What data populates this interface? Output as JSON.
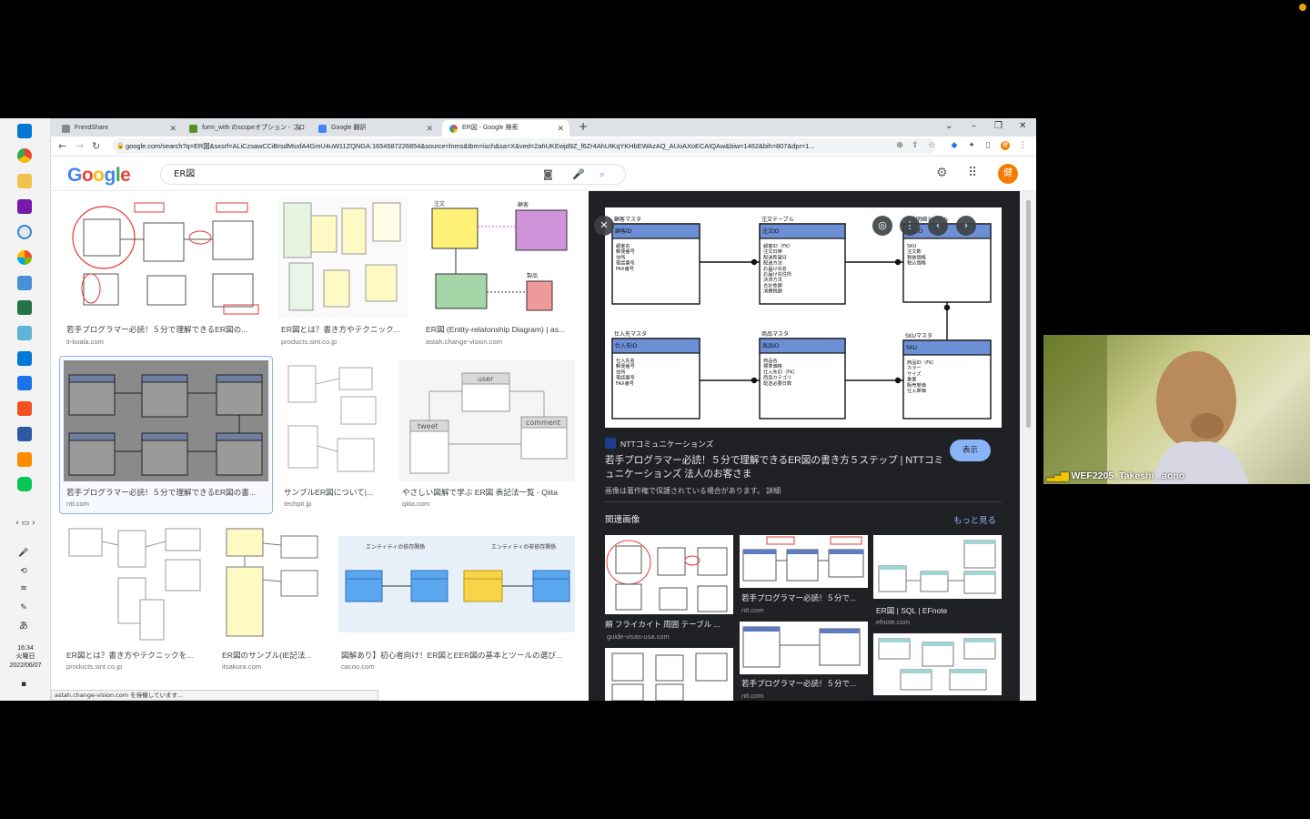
{
  "tabs": [
    {
      "label": "FrendShare",
      "active": false
    },
    {
      "label": "form_with のscopeオプション - プロ",
      "active": false
    },
    {
      "label": "Google 翻訳",
      "active": false
    },
    {
      "label": "ER図 - Google 検索",
      "active": true
    }
  ],
  "url": "google.com/search?q=ER図&sxsrf=ALiCzsawCCiBrsdMsxfA4GmU4uW11ZQNGA:1654587226854&source=lnms&tbm=isch&sa=X&ved=2ahUKEwjd9Z_f6Zr4AhUtKqYKHbEWAzAQ_AUoAXoECAIQAw&biw=1462&bih=807&dpr=1...",
  "search_query": "ER図",
  "google_logo": "Google",
  "avatar_letter": "健",
  "results": [
    {
      "caption": "若手プログラマー必読！５分で理解できるER図の...",
      "source": "it-koala.com"
    },
    {
      "caption": "ER図とは？書き方やテクニック...",
      "source": "products.sint.co.jp"
    },
    {
      "caption": "ER図 (Entity-relatonship Diagram) | as...",
      "source": "astah.change-vision.com"
    },
    {
      "caption": "若手プログラマー必読！５分で理解できるER図の書...",
      "source": "ntt.com"
    },
    {
      "caption": "サンプルER図について|...",
      "source": "techpit.jp"
    },
    {
      "caption": "やさしい図解で学ぶ ER図 表記法一覧 - Qiita",
      "source": "qiita.com"
    },
    {
      "caption": "ER図とは？書き方やテクニックを...",
      "source": "products.sint.co.jp"
    },
    {
      "caption": "ER図のサンプル(IE記法...",
      "source": "itsakura.com"
    },
    {
      "caption": "図解あり】初心者向け！ER図とEER図の基本とツールの選び...",
      "source": "cacoo.com"
    }
  ],
  "status_text": "astah.change-vision.com を待機しています...",
  "preview": {
    "site": "NTTコミュニケーションズ",
    "title_line1": "若手プログラマー必読！５分で理解できるER図の書き方５ステップ | NTTコミ",
    "title_line2": "ュニケーションズ 法人のお客さま",
    "view_button": "表示",
    "copyright": "画像は著作権で保護されている場合があります。 詳細",
    "related_heading": "関連画像",
    "more_link": "もっと見る",
    "related": [
      {
        "caption": "頬 フライカイト 周囲 テーブル ...",
        "source": "guide-visas-usa.com"
      },
      {
        "caption": "若手プログラマー必読！５分で...",
        "source": "ntt.com"
      },
      {
        "caption": "ER図 | SQL | EFnote",
        "source": "efnote.com"
      },
      {
        "caption": "若手プログラマー必読！５分で...",
        "source": "ntt.com"
      }
    ],
    "diagram": {
      "e1": "顧客マスタ",
      "e2": "注文テーブル",
      "e3": "注文明細テーブル",
      "e4": "仕入先マスタ",
      "e5": "商品マスタ",
      "e6": "SKUマスタ",
      "k1": "顧客ID",
      "k2": "注文ID",
      "k3": "注文ID",
      "k4": "仕入先ID",
      "k5": "商品ID",
      "k6": "SKU",
      "a1": "顧客名\n郵便番号\n住所\n電話番号\nFAX番号",
      "a2": "顧客ID（FK）\n注文日時\n配送希望日\n配送方法\nお届け先名\nお届け先住所\n決済方法\n合計金額\n消費税額",
      "a3": "SKU\n注文数\n税抜価格\n税込価格",
      "a4": "仕入先名\n郵便番号\n住所\n電話番号\nFAX番号",
      "a5": "商品名\n標準価格\n仕入先ID（FK）\n商品カテゴリ\n配送必要日数",
      "a6": "商品ID（FK）\nカラー\nサイズ\n重量\n販売単価\n仕入単価"
    }
  },
  "taskbar": {
    "time": "16:34",
    "weekday": "火曜日",
    "date": "2022/06/07"
  },
  "video": {
    "name": "WEF2205_Takeshi _aono"
  },
  "colors": {
    "google_blue": "#4285f4",
    "google_red": "#ea4335",
    "google_yellow": "#fbbc05",
    "google_green": "#34a853",
    "accent": "#8ab4f8"
  }
}
